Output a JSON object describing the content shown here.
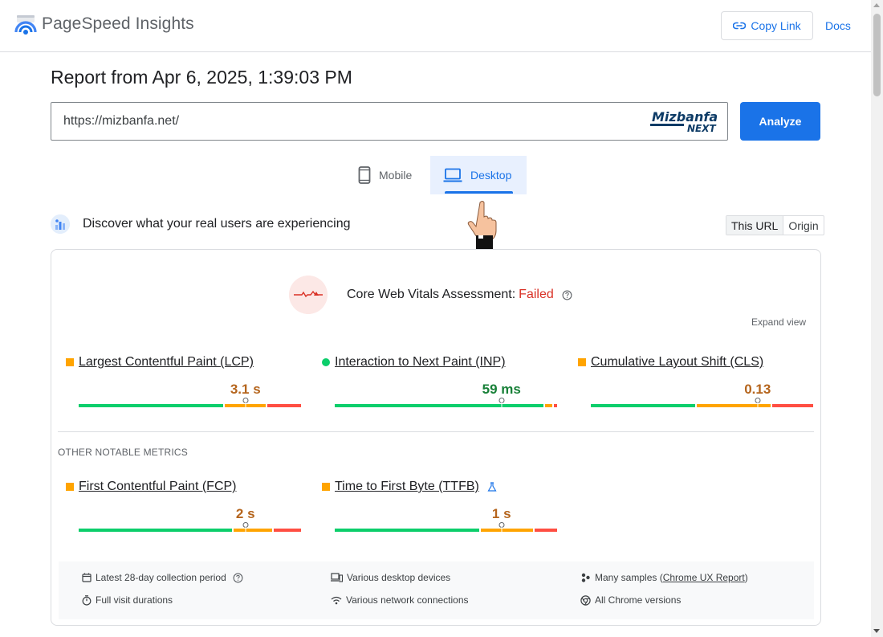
{
  "header": {
    "app_title": "PageSpeed Insights",
    "copy_link": "Copy Link",
    "docs": "Docs"
  },
  "report": {
    "title": "Report from Apr 6, 2025, 1:39:03 PM",
    "url_value": "https://mizbanfa.net/",
    "brand_logo_text": "Mizbanfa",
    "brand_logo_sub": "NEXT",
    "analyze_label": "Analyze"
  },
  "tabs": [
    {
      "label": "Mobile",
      "active": false,
      "icon": "phone-icon"
    },
    {
      "label": "Desktop",
      "active": true,
      "icon": "laptop-icon"
    }
  ],
  "discover": {
    "text": "Discover what your real users are experiencing",
    "toggle": [
      {
        "label": "This URL",
        "active": true
      },
      {
        "label": "Origin",
        "active": false
      }
    ]
  },
  "cwv": {
    "label": "Core Web Vitals Assessment:",
    "status": "Failed",
    "expand_view": "Expand view"
  },
  "metrics": [
    {
      "name": "Largest Contentful Paint (LCP)",
      "value": "3.1 s",
      "rating": "needs-improvement",
      "marker": "square",
      "dist": [
        0.65,
        0.19,
        0.16
      ],
      "pin": 0.75
    },
    {
      "name": "Interaction to Next Paint (INP)",
      "value": "59 ms",
      "rating": "good",
      "marker": "circle",
      "dist": [
        0.94,
        0.04,
        0.02
      ],
      "pin": 0.75
    },
    {
      "name": "Cumulative Layout Shift (CLS)",
      "value": "0.13",
      "rating": "needs-improvement",
      "marker": "square",
      "dist": [
        0.47,
        0.34,
        0.19
      ],
      "pin": 0.75
    }
  ],
  "other": {
    "title": "OTHER NOTABLE METRICS",
    "metrics": [
      {
        "name": "First Contentful Paint (FCP)",
        "value": "2 s",
        "rating": "needs-improvement",
        "marker": "square",
        "dist": [
          0.69,
          0.18,
          0.13
        ],
        "pin": 0.75
      },
      {
        "name": "Time to First Byte (TTFB)",
        "value": "1 s",
        "rating": "needs-improvement",
        "marker": "square",
        "dist": [
          0.65,
          0.24,
          0.11
        ],
        "pin": 0.75,
        "experimental": true
      }
    ]
  },
  "info": {
    "collection_period": "Latest 28-day collection period",
    "visit_durations": "Full visit durations",
    "devices": "Various desktop devices",
    "network": "Various network connections",
    "samples_prefix": "Many samples (",
    "samples_link": "Chrome UX Report",
    "samples_suffix": ")",
    "chrome_versions": "All Chrome versions"
  },
  "colors": {
    "accent": "#1a73e8",
    "good": "#0cce6b",
    "average": "#ffa400",
    "poor": "#ff4e42",
    "failed": "#d93025"
  }
}
